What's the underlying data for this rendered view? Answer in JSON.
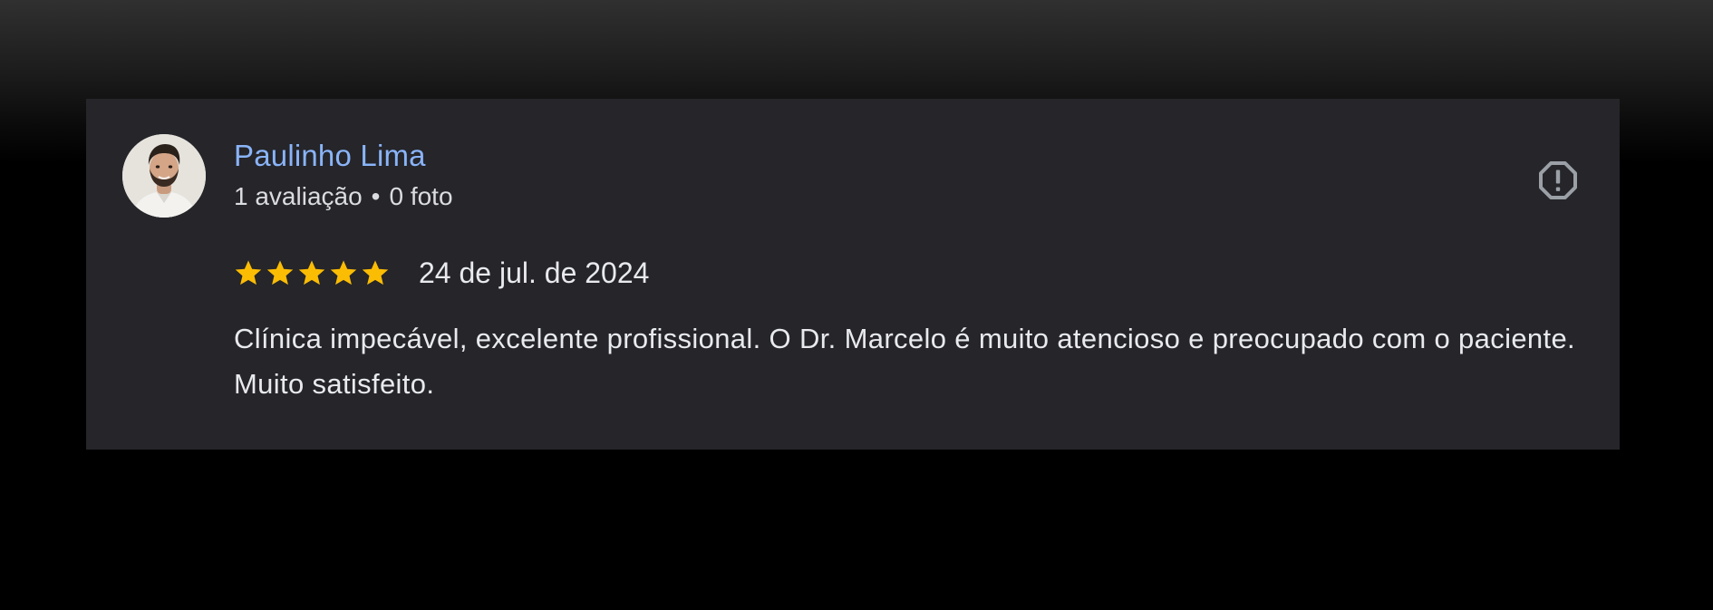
{
  "review": {
    "reviewer_name": "Paulinho Lima",
    "review_count": "1 avaliação",
    "separator": "•",
    "photo_count": "0 foto",
    "rating": 5,
    "rating_max": 5,
    "date": "24 de jul. de 2024",
    "text": "Clínica impecável, excelente profissional. O Dr. Marcelo é muito atencioso e preocupado com o paciente. Muito satisfeito."
  },
  "icons": {
    "avatar": "avatar-photo",
    "report": "report-flag-icon",
    "star": "star-icon"
  },
  "colors": {
    "card_background": "#25252a",
    "name_link": "#8ab4f8",
    "star": "#fbbc04",
    "text": "#e8eaed",
    "meta_text": "#dadce0",
    "icon": "#9aa0a6"
  }
}
